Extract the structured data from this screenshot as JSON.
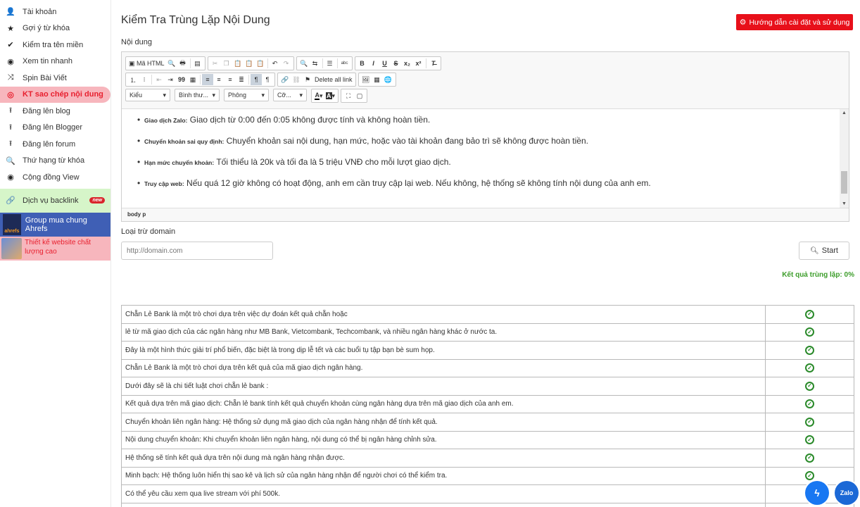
{
  "sidebar": {
    "items": [
      {
        "label": "Tài khoản",
        "icon": "user-icon",
        "glyph": "👤"
      },
      {
        "label": "Gợi ý từ khóa",
        "icon": "star-icon",
        "glyph": "★"
      },
      {
        "label": "Kiểm tra tên miền",
        "icon": "check-icon",
        "glyph": "✔"
      },
      {
        "label": "Xem tin nhanh",
        "icon": "eye-icon",
        "glyph": "◉"
      },
      {
        "label": "Spin Bài Viết",
        "icon": "shuffle-icon",
        "glyph": "⤨"
      },
      {
        "label": "KT sao chép nội dung",
        "icon": "copy-check-icon",
        "glyph": "◎"
      },
      {
        "label": "Đăng lên blog",
        "icon": "upload-icon",
        "glyph": "⭱"
      },
      {
        "label": "Đăng lên Blogger",
        "icon": "upload-icon",
        "glyph": "⭱"
      },
      {
        "label": "Đăng lên forum",
        "icon": "upload-icon",
        "glyph": "⭱"
      },
      {
        "label": "Thứ hạng từ khóa",
        "icon": "search-icon",
        "glyph": "🔍"
      },
      {
        "label": "Cộng đồng View",
        "icon": "eye-icon",
        "glyph": "◉"
      }
    ],
    "backlink": {
      "label": "Dịch vụ backlink",
      "badge": "new"
    },
    "ahrefs": {
      "label": "Group mua chung Ahrefs",
      "logo_text": "ahrefs"
    },
    "design": {
      "label": "Thiết kế website chất lượng cao"
    }
  },
  "main": {
    "title": "Kiểm Tra Trùng Lặp Nội Dung",
    "guide_button": "Hướng dẫn cài đặt và sử dụng",
    "content_label": "Nội dung",
    "exclude_label": "Loại trừ domain",
    "domain_placeholder": "http://domain.com",
    "start_button": "Start",
    "result_text": "Kết quả trùng lặp: 0%"
  },
  "editor": {
    "toolbar": {
      "source_label": "Mã HTML",
      "delete_links_label": "Delete all link",
      "combo_style": "Kiểu",
      "combo_format": "Bình thư...",
      "combo_font": "Phông",
      "combo_size": "Cỡ..."
    },
    "items": [
      {
        "bold": "Giao dịch Zalo:",
        "text": " Giao dịch từ 0:00 đến 0:05 không được tính và không hoàn tiền."
      },
      {
        "bold": "Chuyển khoản sai quy định:",
        "text": " Chuyển khoản sai nội dung, hạn mức, hoặc vào tài khoản đang bảo trì sẽ không được hoàn tiền."
      },
      {
        "bold": "Hạn mức chuyển khoản:",
        "text": " Tối thiểu là 20k và tối đa là 5 triệu VNĐ cho mỗi lượt giao dịch."
      },
      {
        "bold": "Truy cập web:",
        "text": " Nếu quá 12 giờ không có hoạt động, anh em cần truy cập lại web. Nếu không, hệ thống sẽ không tính nội dung của anh em."
      }
    ],
    "status_path": "body  p"
  },
  "results": [
    "Chẵn Lẻ Bank là một trò chơi dựa trên việc dự đoán kết quả chẵn hoặc",
    "lẻ từ mã giao dịch của các ngân hàng như MB Bank, Vietcombank, Techcombank, và nhiều ngân hàng khác ở nước ta.",
    "Đây là một hình thức giải trí phổ biến, đặc biệt là trong dịp lễ tết và các buổi tụ tập bạn bè sum họp.",
    "Chẵn Lẻ Bank là một trò chơi dựa trên kết quả của mã giao dịch ngân hàng.",
    "Dưới đây sẽ là chi tiết luật chơi chẵn lẻ bank :",
    "Kết quả dựa trên mã giao dịch: Chẵn lẻ bank tính kết quả chuyển khoản cùng ngân hàng dựa trên mã giao dịch của anh em.",
    "Chuyển khoản liên ngân hàng: Hệ thống sử dụng mã giao dịch của ngân hàng nhận để tính kết quả.",
    "Nội dung chuyển khoản: Khi chuyển khoản liên ngân hàng, nội dung có thể bị ngân hàng chỉnh sửa.",
    "Hệ thống sẽ tính kết quả dựa trên nội dung mà ngân hàng nhận được.",
    "Minh bạch: Hệ thống luôn hiển thị sao kê và lịch sử của ngân hàng nhận để người chơi có thể kiểm tra.",
    "Có thể yêu cầu xem qua live stream với phí 500k.",
    ""
  ],
  "colors": {
    "accent": "#e8101a",
    "active_bg": "#f7b6bd",
    "success": "#3c9d2a"
  }
}
